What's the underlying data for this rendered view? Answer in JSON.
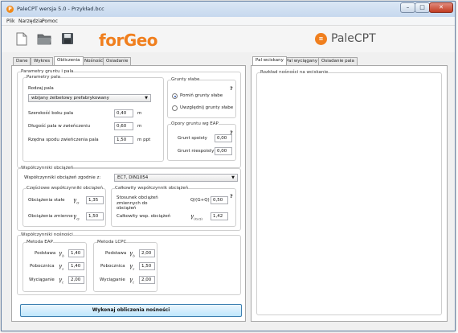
{
  "window": {
    "title": "PaleCPT wersja 5.0 - Przykład.bcc"
  },
  "menu": [
    "Plik",
    "Narzędzia",
    "Pomoc"
  ],
  "logos": {
    "forgeo_prefix": "for",
    "forgeo_suffix": "Geo",
    "palecpt": "PaleCPT"
  },
  "left_tabs": [
    "Dane",
    "Wykres",
    "Obliczenia",
    "Nośność",
    "Osiadanie"
  ],
  "right_tabs": [
    "Pal wciskany",
    "Pal wyciągany",
    "Osiadanie pala"
  ],
  "params_group": {
    "title": "Parametry gruntu i pala",
    "pile_title": "Parametry pala",
    "pile_type_label": "Rodzaj pala",
    "pile_type_value": "wbijany żelbetowy prefabrykowany",
    "rows": [
      {
        "label": "Szerokość boku pala",
        "value": "0,40",
        "unit": "m"
      },
      {
        "label": "Długość pala w zwieńczeniu",
        "value": "0,60",
        "unit": "m"
      },
      {
        "label": "Rzędna spodu zwieńczenia pala",
        "value": "1,50",
        "unit": "m ppt"
      }
    ],
    "weak_soils": {
      "title": "Grunty słabe",
      "option_ignore": "Pomiń grunty słabe",
      "option_consider": "Uwzględnij grunty słabe",
      "help": "?"
    },
    "eap": {
      "title": "Opory gruntu wg EAP",
      "rows": [
        {
          "label": "Grunt spoisty",
          "value": "0,00"
        },
        {
          "label": "Grunt niespoisty",
          "value": "0,00"
        }
      ],
      "help": "?"
    }
  },
  "load_factors": {
    "title": "Współczynniki obciążeń",
    "by_label": "Współczynniki obciążeń zgodnie z:",
    "by_value": "EC7, DIN1054",
    "partial": {
      "title": "Częściowe współczynniki obciążeń",
      "rows": [
        {
          "label": "Obciążenia stałe",
          "symbol": "γ",
          "sub": "G",
          "value": "1,35"
        },
        {
          "label": "Obciążenia zmienne",
          "symbol": "γ",
          "sub": "Q",
          "value": "1,50"
        }
      ]
    },
    "total": {
      "title": "Całkowity współczynnik obciążeń",
      "ratio_label": "Stosunek obciążeń zmiennych do obciążeń",
      "ratio_symbol": "Q/(G+Q)",
      "ratio_value": "0,50",
      "total_label": "Całkowity wsp. obciążeń",
      "total_symbol": "γ",
      "total_sub": "(G,Q)",
      "total_value": "1,42",
      "help": "?"
    }
  },
  "capacity_factors": {
    "title": "Współczynniki nośności",
    "eap": {
      "title": "Metoda EAP",
      "rows": [
        {
          "label": "Podstawa",
          "symbol": "γ",
          "sub": "b",
          "value": "1,40"
        },
        {
          "label": "Pobocznica",
          "symbol": "γ",
          "sub": "s",
          "value": "1,40"
        },
        {
          "label": "Wyciąganie",
          "symbol": "γ",
          "sub": "t",
          "value": "2,00"
        }
      ]
    },
    "lcpc": {
      "title": "Metoda LCPC",
      "rows": [
        {
          "label": "Podstawa",
          "symbol": "γ",
          "sub": "b",
          "value": "2,00"
        },
        {
          "label": "Pobocznica",
          "symbol": "γ",
          "sub": "s",
          "value": "1,50"
        },
        {
          "label": "Wyciąganie",
          "symbol": "γ",
          "sub": "t",
          "value": "2,00"
        }
      ]
    }
  },
  "run_button": "Wykonaj obliczenia nośności",
  "right_panel": {
    "title": "Rozkład nośności na wciskanie"
  }
}
